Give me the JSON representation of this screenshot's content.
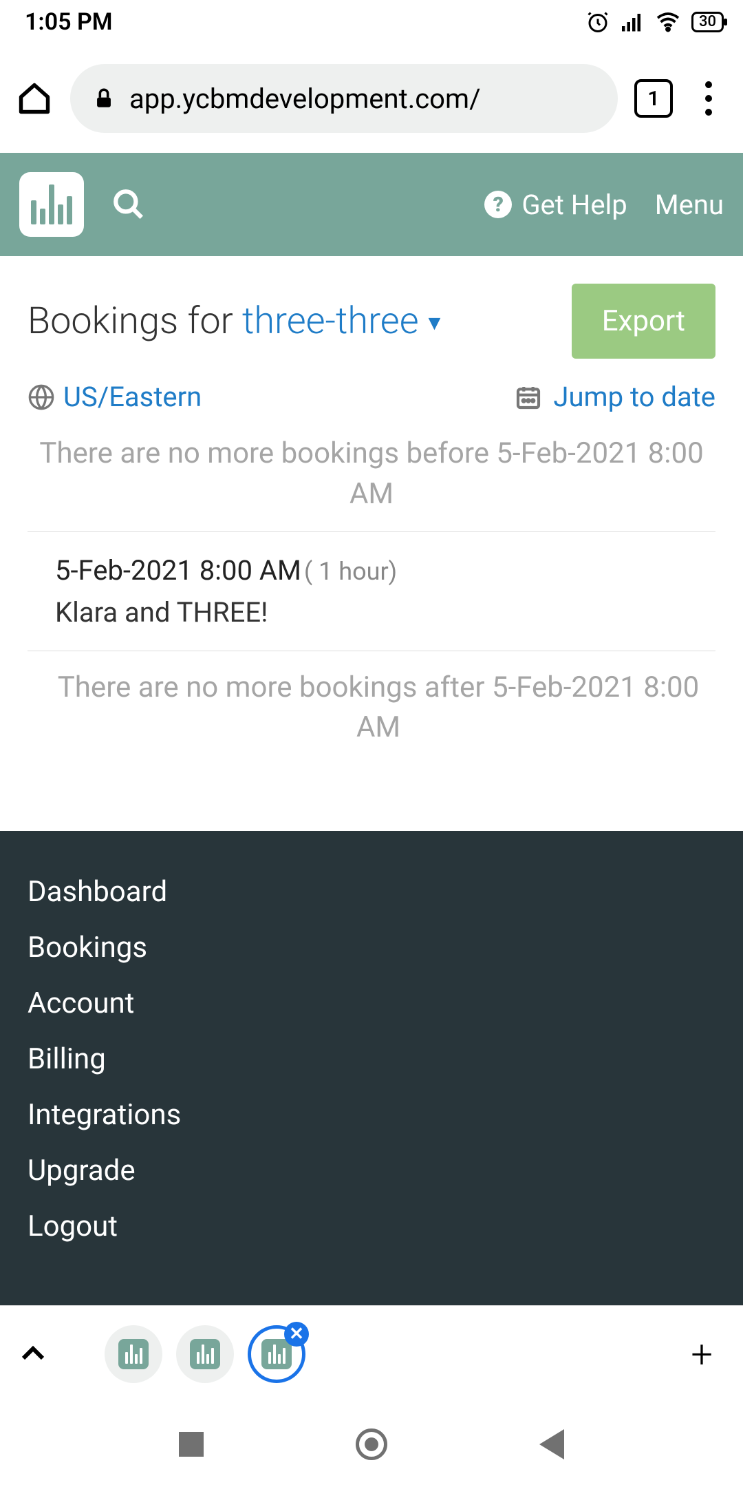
{
  "status": {
    "time": "1:05 PM",
    "battery": "30"
  },
  "browser": {
    "url": "app.ycbmdevelopment.com/",
    "tab_count": "1"
  },
  "header": {
    "help": "Get Help",
    "menu": "Menu"
  },
  "title": {
    "prefix": "Bookings for ",
    "calendar": "three-three"
  },
  "export_label": "Export",
  "timezone": "US/Eastern",
  "jump_label": "Jump to date",
  "before_msg": "There are no more bookings before 5-Feb-2021 8:00 AM",
  "after_msg": "There are no more bookings after 5-Feb-2021 8:00 AM",
  "booking": {
    "datetime": "5-Feb-2021 8:00 AM",
    "duration": "( 1 hour)",
    "title": "Klara and THREE!"
  },
  "footer": {
    "items": [
      "Dashboard",
      "Bookings",
      "Account",
      "Billing",
      "Integrations",
      "Upgrade",
      "Logout"
    ]
  }
}
